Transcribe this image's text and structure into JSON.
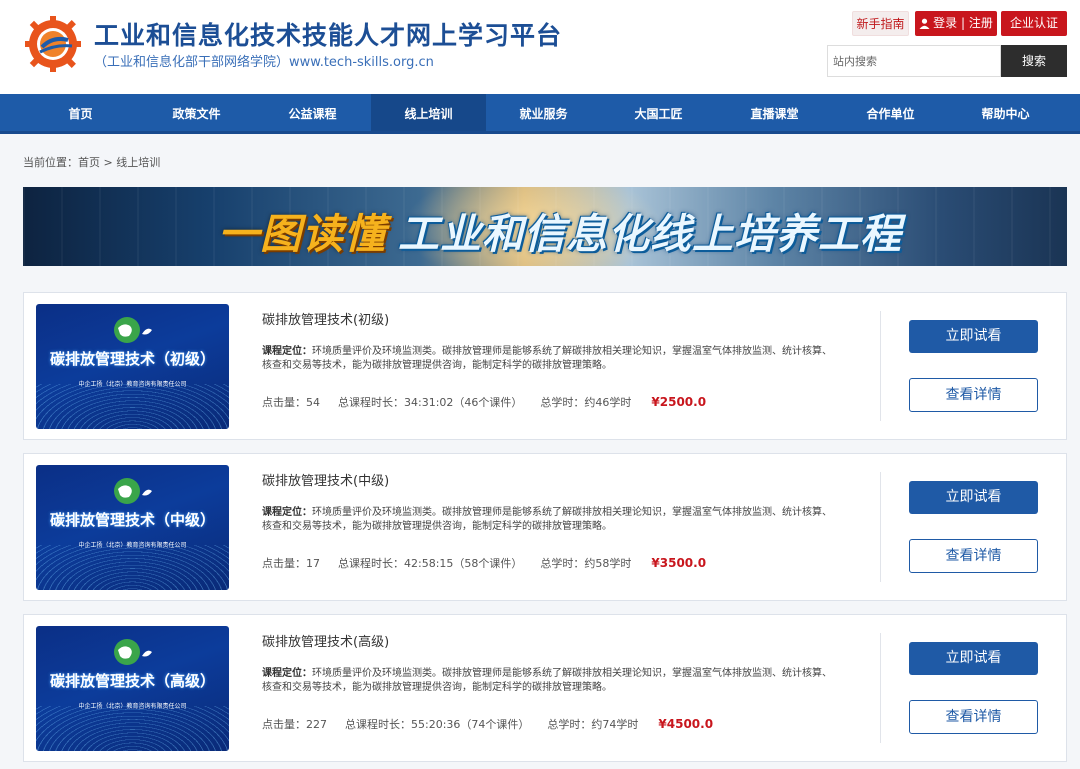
{
  "header": {
    "title": "工业和信息化技术技能人才网上学习平台",
    "subtitle": "（工业和信息化部干部网络学院）www.tech-skills.org.cn",
    "guide_label": "新手指南",
    "login_label": "登录 | 注册",
    "enterprise_label": "企业认证",
    "search_placeholder": "站内搜索",
    "search_label": "搜索",
    "logo_icon": "gear-globe-logo",
    "brand_colors": {
      "primary": "#1e5ba8",
      "accent": "#c8161d"
    }
  },
  "nav": {
    "items": [
      {
        "label": "首页"
      },
      {
        "label": "政策文件"
      },
      {
        "label": "公益课程"
      },
      {
        "label": "线上培训",
        "active": true
      },
      {
        "label": "就业服务"
      },
      {
        "label": "大国工匠"
      },
      {
        "label": "直播课堂"
      },
      {
        "label": "合作单位"
      },
      {
        "label": "帮助中心"
      }
    ]
  },
  "breadcrumb": {
    "prefix": "当前位置：",
    "home": "首页",
    "separator": " > ",
    "current": "线上培训"
  },
  "banner": {
    "text_gold": "一图读懂",
    "text_blue": "工业和信息化线上培养工程"
  },
  "courses": [
    {
      "title": "碳排放管理技术(初级)",
      "thumb_title": "碳排放管理技术（初级）",
      "thumb_company": "中企工扬（北京）教育咨询有限责任公司",
      "desc_label": "课程定位：",
      "desc": "环境质量评价及环境监测类。碳排放管理师是能够系统了解碳排放相关理论知识，掌握温室气体排放监测、统计核算、核查和交易等技术，能为碳排放管理提供咨询，能制定科学的碳排放管理策略。",
      "clicks": "点击量：54",
      "duration": "总课程时长：34:31:02（46个课件）",
      "hours": "总学时：约46学时",
      "price": "¥2500.0",
      "try_label": "立即试看",
      "detail_label": "查看详情"
    },
    {
      "title": "碳排放管理技术(中级)",
      "thumb_title": "碳排放管理技术（中级）",
      "thumb_company": "中企工扬（北京）教育咨询有限责任公司",
      "desc_label": "课程定位：",
      "desc": "环境质量评价及环境监测类。碳排放管理师是能够系统了解碳排放相关理论知识，掌握温室气体排放监测、统计核算、核查和交易等技术，能为碳排放管理提供咨询，能制定科学的碳排放管理策略。",
      "clicks": "点击量：17",
      "duration": "总课程时长：42:58:15（58个课件）",
      "hours": "总学时：约58学时",
      "price": "¥3500.0",
      "try_label": "立即试看",
      "detail_label": "查看详情"
    },
    {
      "title": "碳排放管理技术(高级)",
      "thumb_title": "碳排放管理技术（高级）",
      "thumb_company": "中企工扬（北京）教育咨询有限责任公司",
      "desc_label": "课程定位：",
      "desc": "环境质量评价及环境监测类。碳排放管理师是能够系统了解碳排放相关理论知识，掌握温室气体排放监测、统计核算、核查和交易等技术，能为碳排放管理提供咨询，能制定科学的碳排放管理策略。",
      "clicks": "点击量：227",
      "duration": "总课程时长：55:20:36（74个课件）",
      "hours": "总学时：约74学时",
      "price": "¥4500.0",
      "try_label": "立即试看",
      "detail_label": "查看详情"
    }
  ]
}
